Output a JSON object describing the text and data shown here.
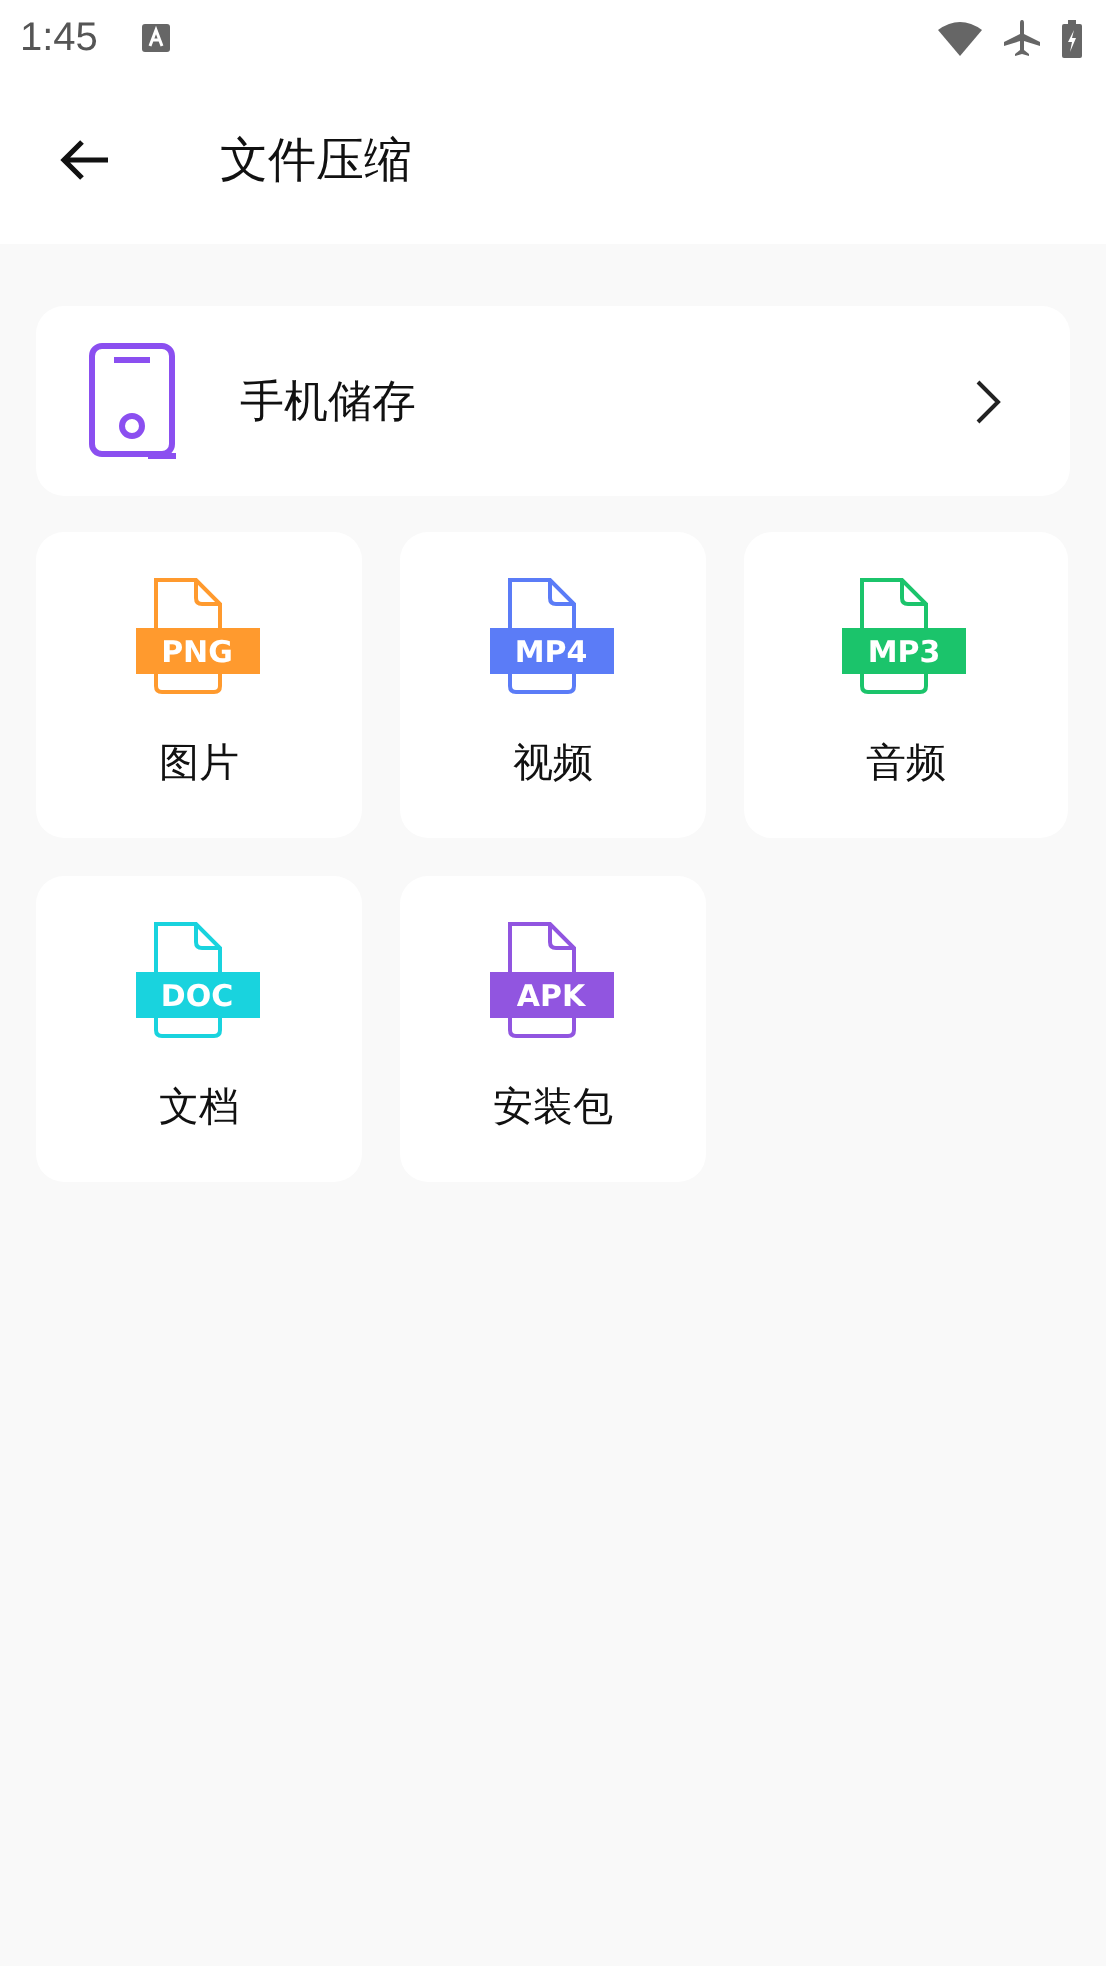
{
  "status_bar": {
    "time": "1:45"
  },
  "header": {
    "title": "文件压缩"
  },
  "storage": {
    "label": "手机储存"
  },
  "categories": [
    {
      "label": "图片",
      "ext": "PNG",
      "color": "#ff9a2e"
    },
    {
      "label": "视频",
      "ext": "MP4",
      "color": "#5b7cf7"
    },
    {
      "label": "音频",
      "ext": "MP3",
      "color": "#1bc46b"
    },
    {
      "label": "文档",
      "ext": "DOC",
      "color": "#19d3de"
    },
    {
      "label": "安装包",
      "ext": "APK",
      "color": "#9155e0"
    }
  ]
}
